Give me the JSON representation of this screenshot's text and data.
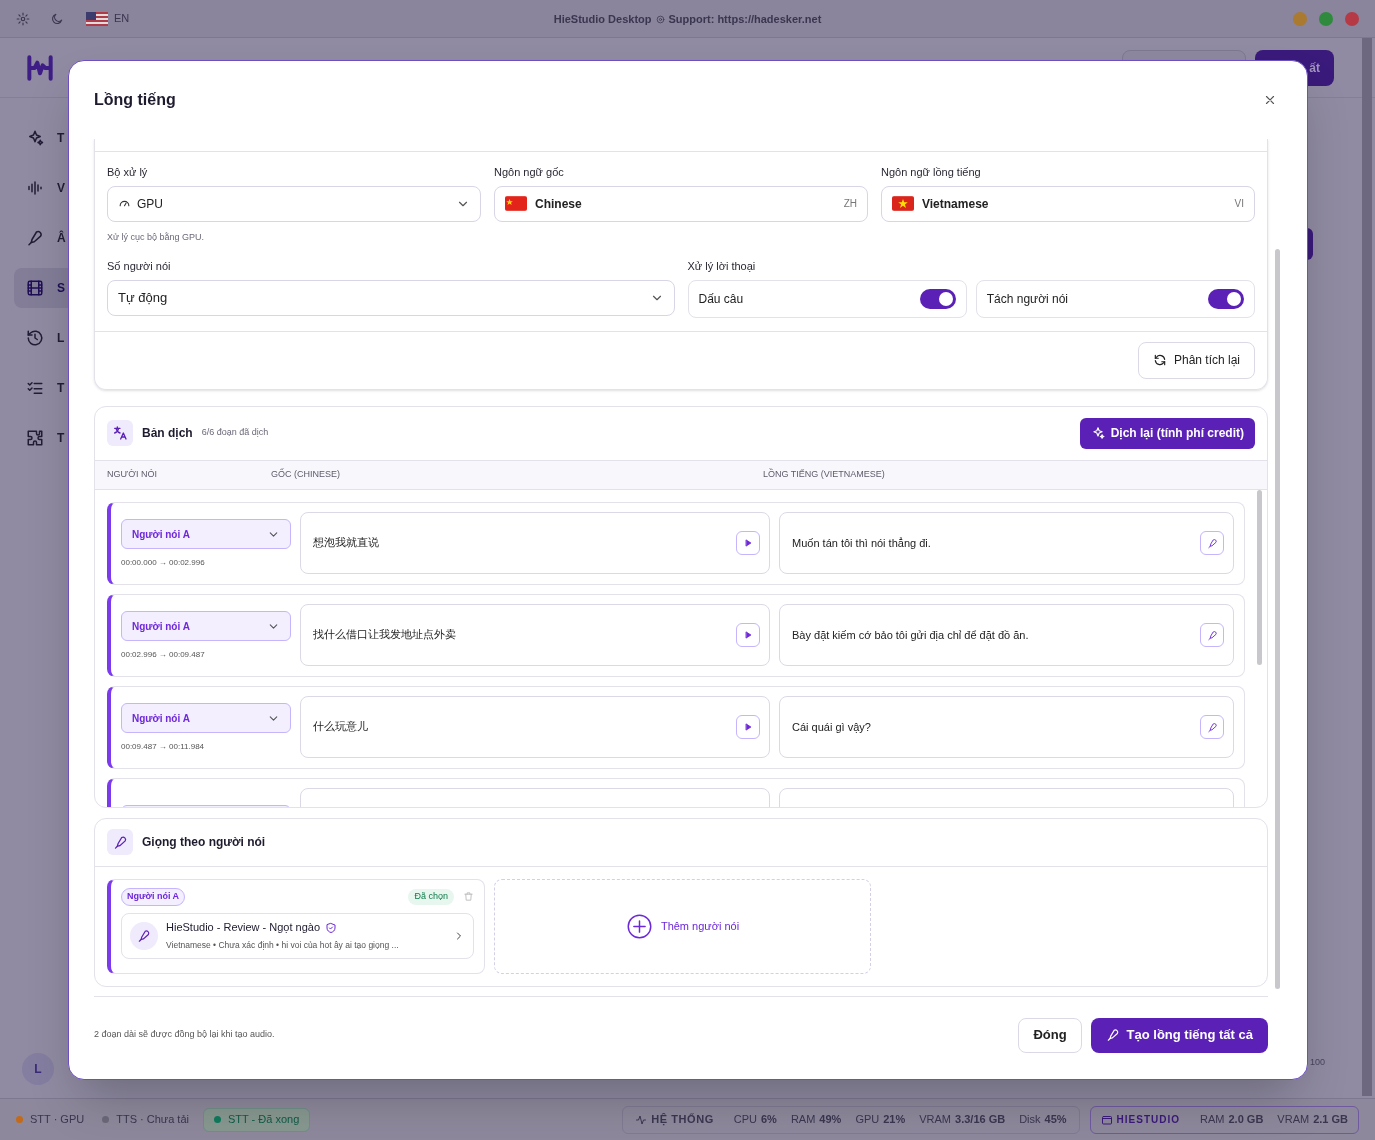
{
  "titlebar": {
    "language": "EN",
    "app_name": "HieStudio Desktop",
    "support": "Support: https://hadesker.net"
  },
  "app": {
    "sidebar": [
      {
        "label": "T",
        "selected": false
      },
      {
        "label": "V",
        "selected": false
      },
      {
        "label": "Â",
        "selected": false
      },
      {
        "label": "S",
        "selected": true
      },
      {
        "label": "L",
        "selected": false
      },
      {
        "label": "T",
        "selected": false
      },
      {
        "label": "T",
        "selected": false
      }
    ],
    "header_button": "ất",
    "avatar": "L",
    "corner_value": "100"
  },
  "dialog": {
    "title": "Lồng tiếng",
    "processor": {
      "label": "Bộ xử lý",
      "value": "GPU",
      "hint": "Xử lý cục bộ bằng GPU."
    },
    "source_language": {
      "label": "Ngôn ngữ gốc",
      "value": "Chinese",
      "code": "ZH"
    },
    "target_language": {
      "label": "Ngôn ngữ lồng tiếng",
      "value": "Vietnamese",
      "code": "VI"
    },
    "speakers": {
      "label": "Số người nói",
      "value": "Tự động"
    },
    "dialogue": {
      "label": "Xử lý lời thoại",
      "toggles": [
        {
          "label": "Dấu câu",
          "on": true
        },
        {
          "label": "Tách người nói",
          "on": true
        }
      ]
    },
    "reanalyze_button": "Phân tích lại",
    "translation": {
      "title": "Bản dịch",
      "count": "6/6 đoạn đã dịch",
      "button": "Dịch lại (tính phí credit)",
      "columns": [
        "NGƯỜI NÓI",
        "GỐC (CHINESE)",
        "LỒNG TIẾNG (VIETNAMESE)"
      ],
      "rows": [
        {
          "speaker": "Người nói A",
          "time": "00:00.000 → 00:02.996",
          "source": "想泡我就直说",
          "target": "Muốn tán tôi thì nói thẳng đi."
        },
        {
          "speaker": "Người nói A",
          "time": "00:02.996 → 00:09.487",
          "source": "找什么借口让我发地址点外卖",
          "target": "Bày đặt kiếm cớ bảo tôi gửi địa chỉ để đặt đồ ăn."
        },
        {
          "speaker": "Người nói A",
          "time": "00:09.487 → 00:11.984",
          "source": "什么玩意儿",
          "target": "Cái quái gì vậy?"
        }
      ]
    },
    "voices": {
      "title": "Giọng theo người nói",
      "cards": [
        {
          "speaker": "Người nói A",
          "status": "Đã chọn",
          "voice": "HieStudio - Review - Ngọt ngào",
          "verified": true,
          "details": "Vietnamese • Chưa xác định • hi voi của hot ây ai tạo giọng ..."
        }
      ],
      "add_button": "Thêm người nói"
    },
    "footer_note": "2 đoạn dài sẽ được đồng bộ lại khi tạo audio.",
    "close_button": "Đóng",
    "create_button": "Tạo lồng tiếng tất cả"
  },
  "status_bar": {
    "left": [
      {
        "label": "STT · GPU",
        "color": "#c2691b",
        "pill": false
      },
      {
        "label": "TTS · Chưa tải",
        "color": "#6b6878",
        "pill": false
      },
      {
        "label": "STT - Đã xong",
        "color": "#0f7a5c",
        "pill": true
      }
    ],
    "system_label": "HỆ THỐNG",
    "system": [
      {
        "label": "CPU",
        "value": "6%"
      },
      {
        "label": "RAM",
        "value": "49%"
      },
      {
        "label": "GPU",
        "value": "21%"
      },
      {
        "label": "VRAM",
        "value": "3.3/16 GB"
      },
      {
        "label": "Disk",
        "value": "45%"
      }
    ],
    "app_label": "HIESTUDIO",
    "app": [
      {
        "label": "RAM",
        "value": "2.0 GB"
      },
      {
        "label": "VRAM",
        "value": "2.1 GB"
      }
    ]
  }
}
